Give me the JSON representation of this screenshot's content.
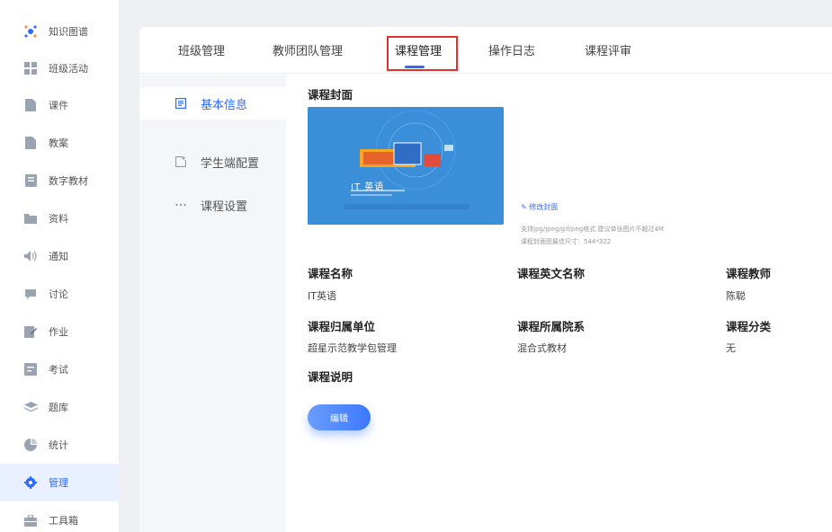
{
  "sidebar": {
    "items": [
      {
        "label": "知识图谱",
        "icon": "knowledge-graph-icon"
      },
      {
        "label": "班级活动",
        "icon": "grid-icon"
      },
      {
        "label": "课件",
        "icon": "file-icon"
      },
      {
        "label": "教案",
        "icon": "file-icon"
      },
      {
        "label": "数字教材",
        "icon": "book-icon"
      },
      {
        "label": "资料",
        "icon": "folder-icon"
      },
      {
        "label": "通知",
        "icon": "speaker-icon"
      },
      {
        "label": "讨论",
        "icon": "chat-icon"
      },
      {
        "label": "作业",
        "icon": "edit-icon"
      },
      {
        "label": "考试",
        "icon": "exam-icon"
      },
      {
        "label": "题库",
        "icon": "stack-icon"
      },
      {
        "label": "统计",
        "icon": "pie-icon"
      },
      {
        "label": "管理",
        "icon": "gear-icon"
      },
      {
        "label": "工具箱",
        "icon": "toolbox-icon"
      }
    ],
    "active_index": 12
  },
  "tabs": {
    "items": [
      "班级管理",
      "教师团队管理",
      "课程管理",
      "操作日志",
      "课程评审"
    ],
    "active_index": 2
  },
  "subnav": {
    "items": [
      {
        "label": "基本信息",
        "icon": "info-icon"
      },
      {
        "label": "学生端配置",
        "icon": "config-icon"
      },
      {
        "label": "课程设置",
        "icon": "more-icon"
      }
    ],
    "active_index": 0
  },
  "course": {
    "cover_label": "课程封面",
    "cover_title": "IT 英语",
    "edit_cover": "修改封面",
    "cover_hint_formats": "支持jpg/jpeg/gif/png格式 建议单张图片不超过4M",
    "cover_hint_size": "课程封面图最佳尺寸：544*322",
    "name_label": "课程名称",
    "name_value": "IT英语",
    "english_name_label": "课程英文名称",
    "english_name_value": "",
    "teacher_label": "课程教师",
    "teacher_value": "陈聪",
    "unit_label": "课程归属单位",
    "unit_value": "超星示范教学包管理",
    "department_label": "课程所属院系",
    "department_value": "混合式教材",
    "category_label": "课程分类",
    "category_value": "无",
    "description_label": "课程说明",
    "edit_button": "编辑"
  },
  "colors": {
    "accent": "#2f6bff",
    "highlight_box": "#e0312f",
    "cover_bg": "#3b8fd8"
  }
}
